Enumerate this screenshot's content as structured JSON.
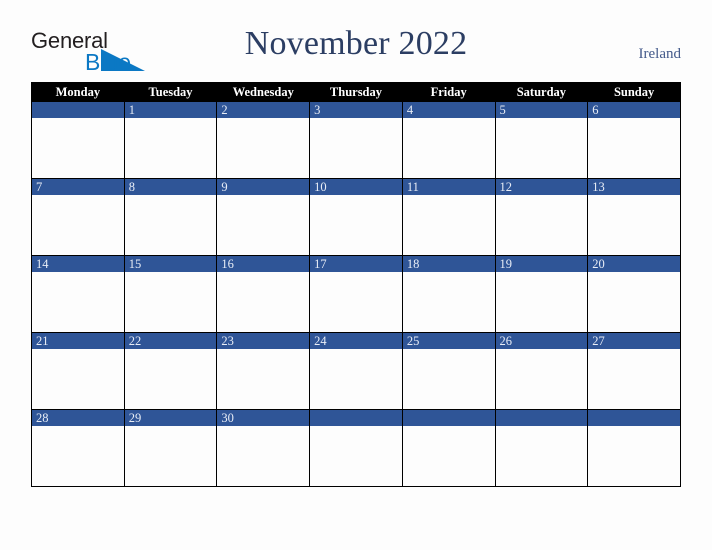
{
  "brand": {
    "name_top": "General",
    "name_bottom": "Blue",
    "triangle_icon": "blue-triangle-icon",
    "color_dark": "#231f20",
    "color_blue": "#0b78c4"
  },
  "header": {
    "title": "November 2022",
    "region": "Ireland",
    "title_color": "#2c3e63",
    "region_color": "#43598a"
  },
  "calendar": {
    "weekdays": [
      "Monday",
      "Tuesday",
      "Wednesday",
      "Thursday",
      "Friday",
      "Saturday",
      "Sunday"
    ],
    "header_bg": "#000000",
    "header_fg": "#ffffff",
    "day_band_bg": "#2f5597",
    "day_band_fg": "#e8edf6",
    "cell_bg": "#fdfdfd",
    "border_color": "#000000",
    "weeks": [
      {
        "days": [
          {
            "num": ""
          },
          {
            "num": "1"
          },
          {
            "num": "2"
          },
          {
            "num": "3"
          },
          {
            "num": "4"
          },
          {
            "num": "5"
          },
          {
            "num": "6"
          }
        ]
      },
      {
        "days": [
          {
            "num": "7"
          },
          {
            "num": "8"
          },
          {
            "num": "9"
          },
          {
            "num": "10"
          },
          {
            "num": "11"
          },
          {
            "num": "12"
          },
          {
            "num": "13"
          }
        ]
      },
      {
        "days": [
          {
            "num": "14"
          },
          {
            "num": "15"
          },
          {
            "num": "16"
          },
          {
            "num": "17"
          },
          {
            "num": "18"
          },
          {
            "num": "19"
          },
          {
            "num": "20"
          }
        ]
      },
      {
        "days": [
          {
            "num": "21"
          },
          {
            "num": "22"
          },
          {
            "num": "23"
          },
          {
            "num": "24"
          },
          {
            "num": "25"
          },
          {
            "num": "26"
          },
          {
            "num": "27"
          }
        ]
      },
      {
        "days": [
          {
            "num": "28"
          },
          {
            "num": "29"
          },
          {
            "num": "30"
          },
          {
            "num": ""
          },
          {
            "num": ""
          },
          {
            "num": ""
          },
          {
            "num": ""
          }
        ]
      }
    ]
  }
}
